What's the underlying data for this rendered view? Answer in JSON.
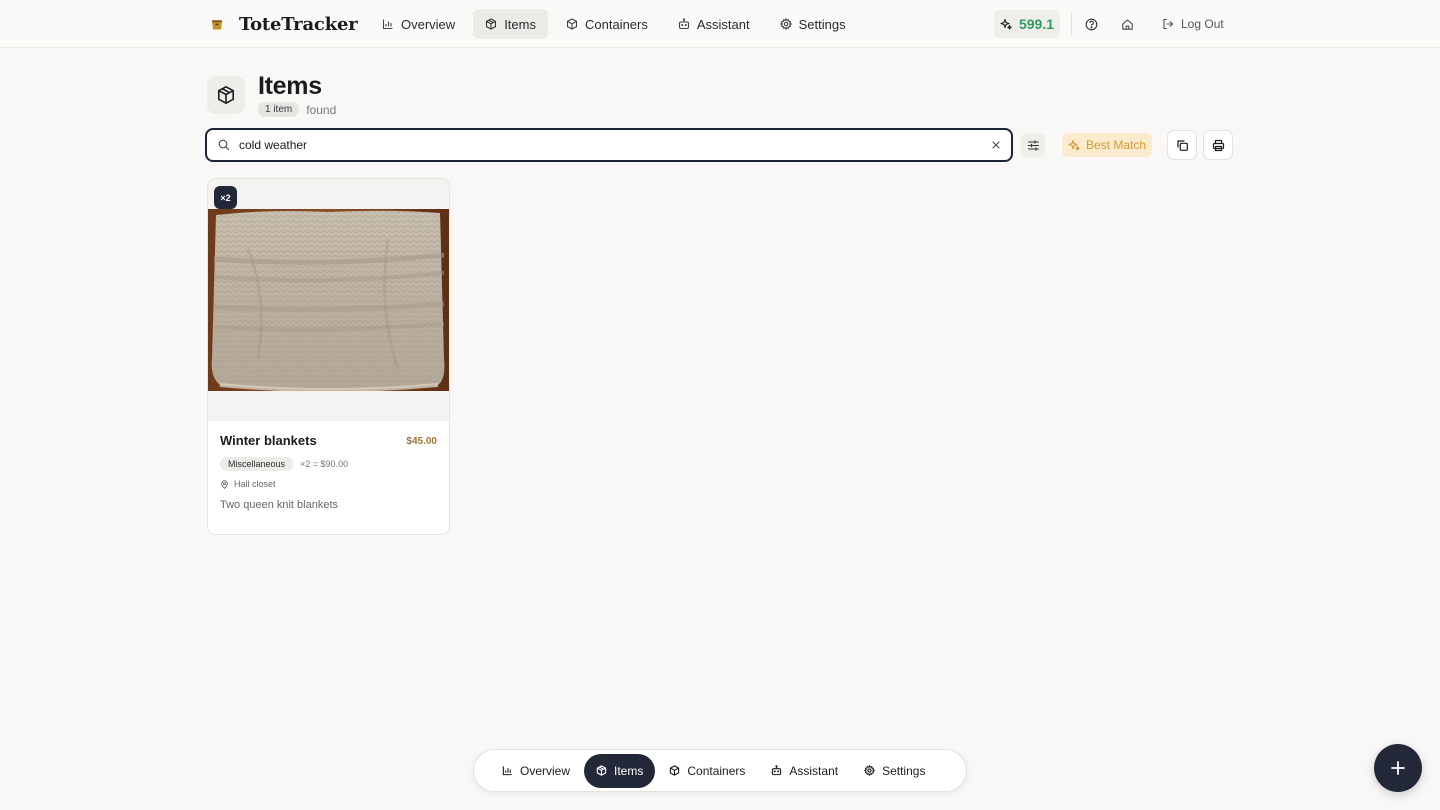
{
  "app": {
    "name": "ToteTracker"
  },
  "topnav": {
    "items": [
      {
        "label": "Overview",
        "icon": "bar-chart-icon",
        "active": false
      },
      {
        "label": "Items",
        "icon": "box-icon",
        "active": true
      },
      {
        "label": "Containers",
        "icon": "package-icon",
        "active": false
      },
      {
        "label": "Assistant",
        "icon": "bot-icon",
        "active": false
      },
      {
        "label": "Settings",
        "icon": "gear-icon",
        "active": false
      }
    ],
    "credits": "599.1",
    "logout_label": "Log Out"
  },
  "page": {
    "title": "Items",
    "count_label": "1 item",
    "count_suffix": "found"
  },
  "search": {
    "value": "cold weather",
    "sort_label": "Best Match"
  },
  "items": [
    {
      "name": "Winter blankets",
      "price": "$45.00",
      "quantity_badge": "×2",
      "category": "Miscellaneous",
      "total": "×2 = $90.00",
      "location": "Hall closet",
      "description": "Two queen knit blankets"
    }
  ],
  "bottomnav": {
    "items": [
      {
        "label": "Overview",
        "icon": "bar-chart-icon",
        "active": false
      },
      {
        "label": "Items",
        "icon": "box-icon",
        "active": true
      },
      {
        "label": "Containers",
        "icon": "package-icon",
        "active": false
      },
      {
        "label": "Assistant",
        "icon": "bot-icon",
        "active": false
      },
      {
        "label": "Settings",
        "icon": "gear-icon",
        "active": false
      }
    ]
  },
  "colors": {
    "primary": "#222838",
    "background": "#f9f8f6",
    "credits_green": "#2f9b62",
    "sort_accent": "#d39a31",
    "price": "#a0743a"
  }
}
